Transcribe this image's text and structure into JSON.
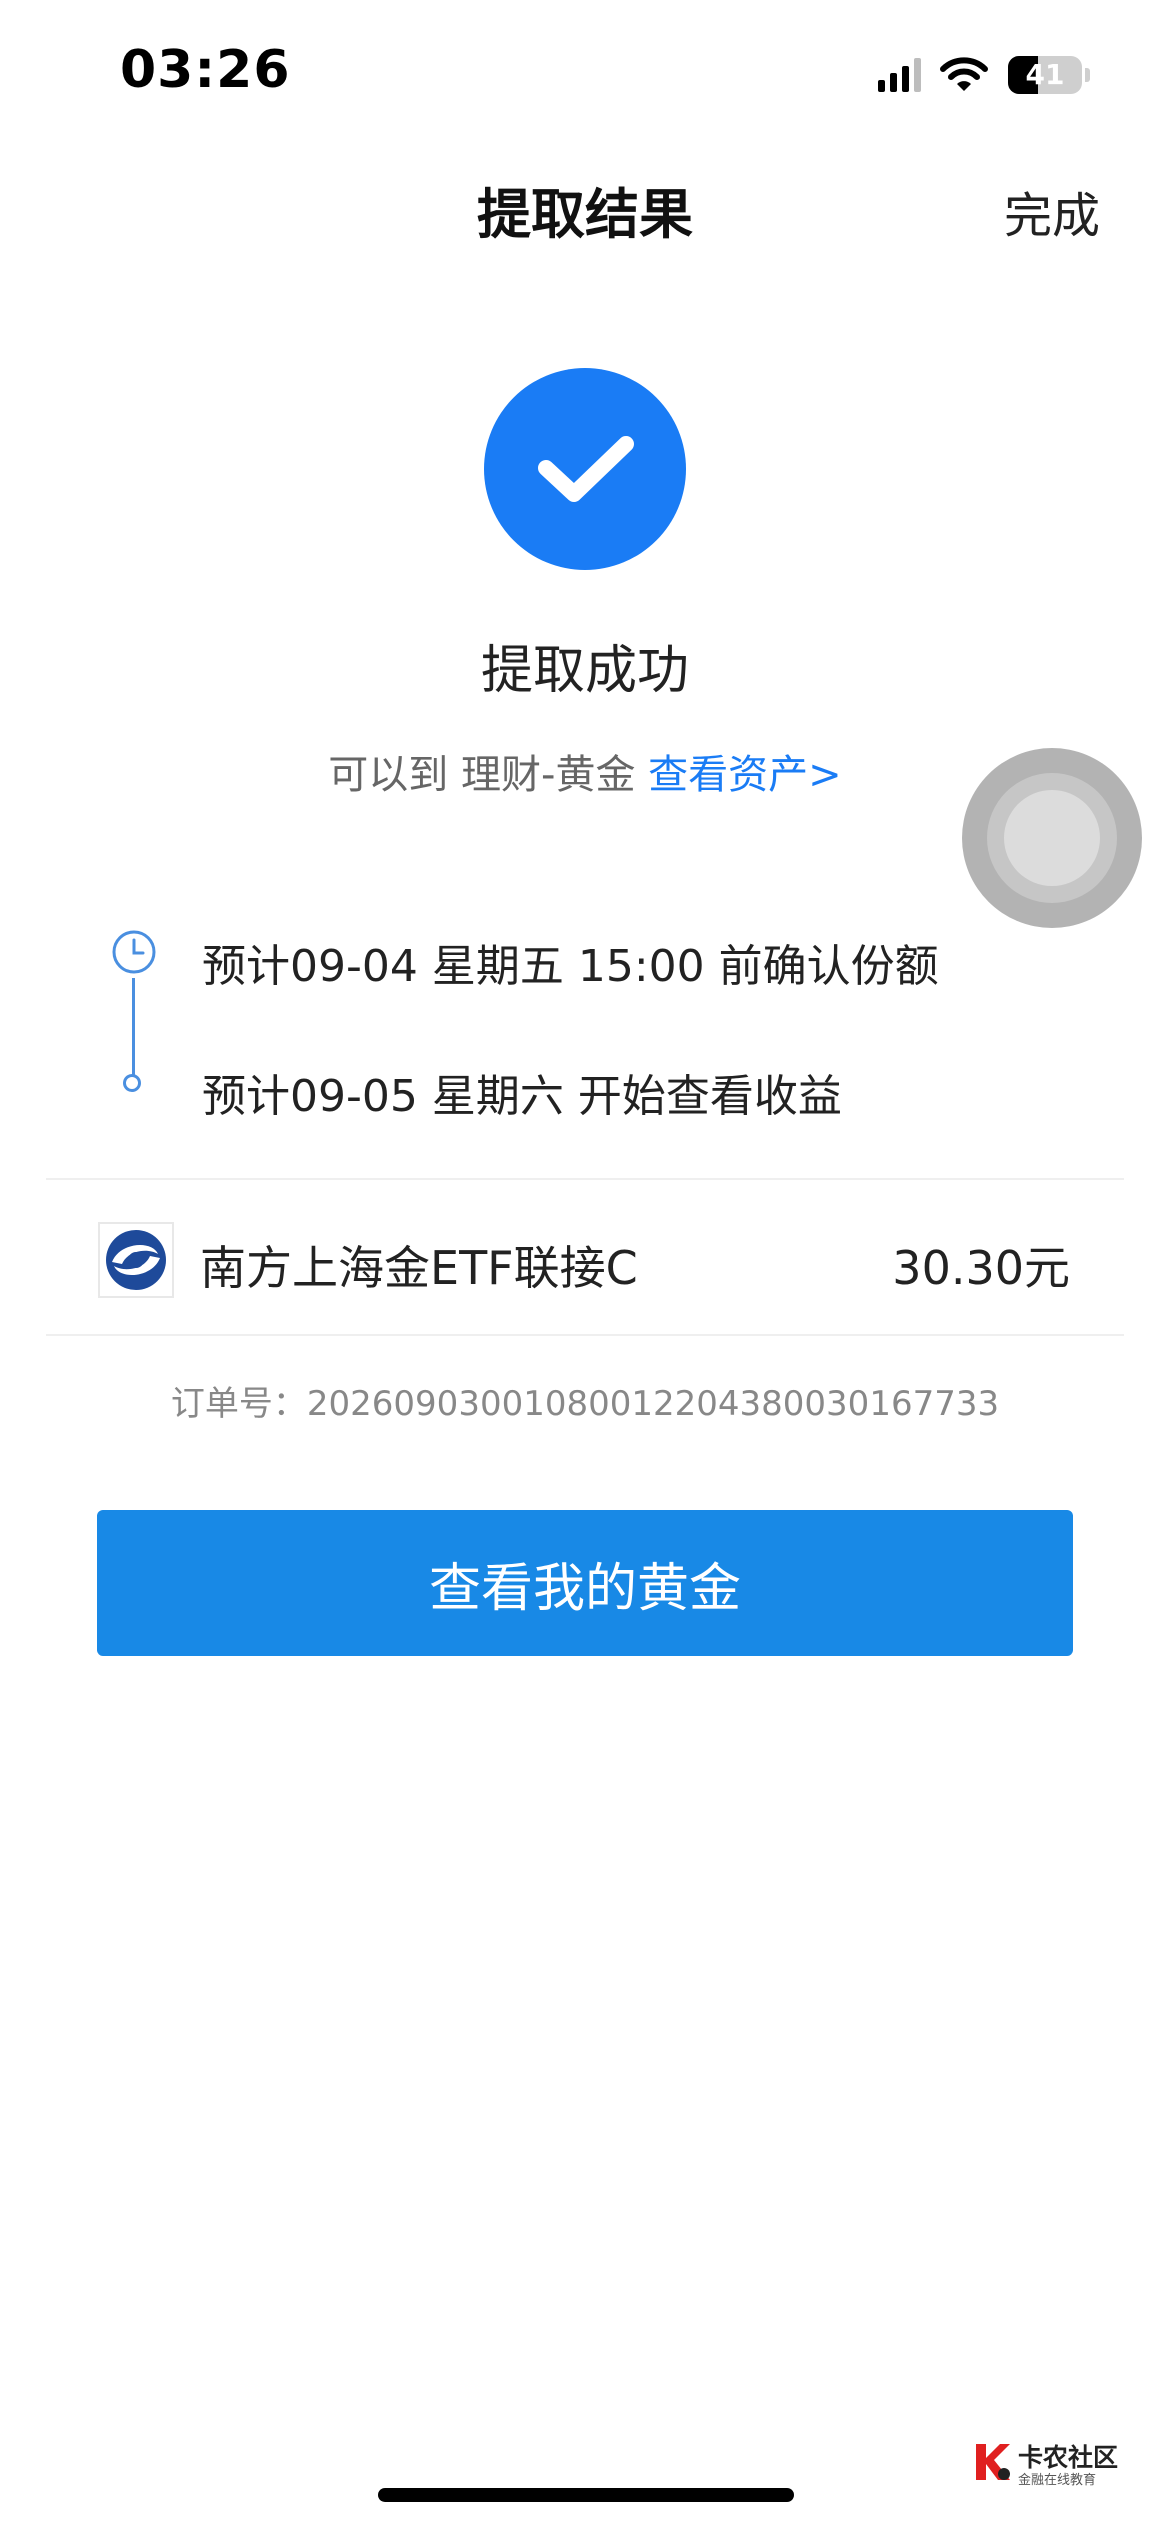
{
  "status_bar": {
    "time": "03:26",
    "battery_level": "41",
    "battery_fraction": 0.41
  },
  "nav": {
    "title": "提取结果",
    "done": "完成"
  },
  "result": {
    "icon": "checkmark-circle-icon",
    "title": "提取成功",
    "sub_prefix": "可以到 理财-黄金 ",
    "sub_link": "查看资产>"
  },
  "timeline": [
    {
      "text": "预计09-04 星期五 15:00 前确认份额"
    },
    {
      "text": "预计09-05 星期六 开始查看收益"
    }
  ],
  "fund": {
    "name": "南方上海金ETF联接C",
    "amount": "30.30元"
  },
  "order": {
    "text": "订单号：2026090300108001220438003016773​3"
  },
  "primary_button": "查看我的黄金",
  "watermark": {
    "name": "卡农社区",
    "slogan": "金融在线教育"
  },
  "colors": {
    "accent": "#1a7cf5",
    "button": "#1889e6",
    "timeline": "#4a8fe0"
  }
}
